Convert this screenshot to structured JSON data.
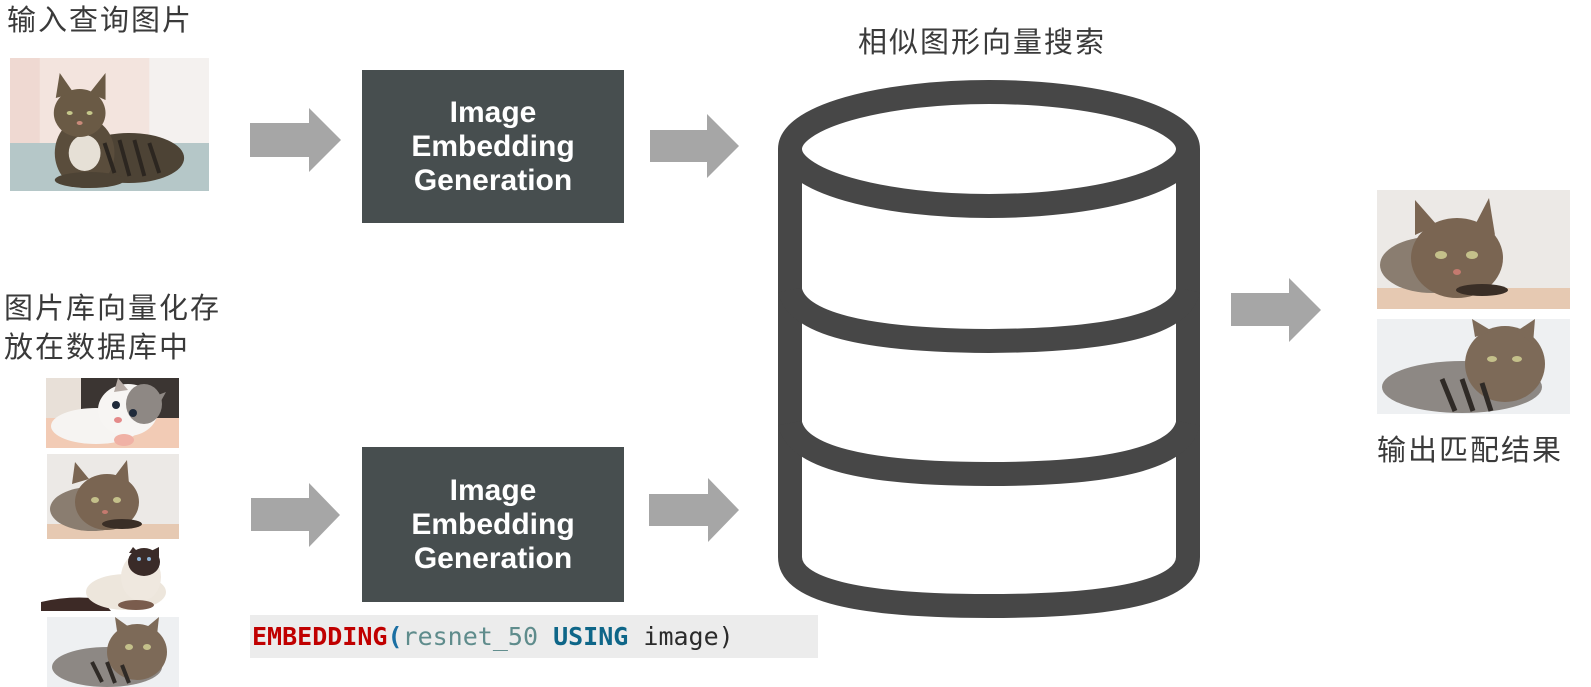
{
  "labels": {
    "query_input": "输入查询图片",
    "gallery_storage_line1": "图片库向量化存",
    "gallery_storage_line2": "放在数据库中",
    "similarity_search": "相似图形向量搜索",
    "output_results": "输出匹配结果"
  },
  "embedding_boxes": [
    {
      "lines": [
        "Image",
        "Embedding",
        "Generation"
      ]
    },
    {
      "lines": [
        "Image",
        "Embedding",
        "Generation"
      ]
    }
  ],
  "code_snippet": {
    "function": "EMBEDDING",
    "open_paren": "(",
    "model": "resnet_50",
    "keyword": "USING",
    "column": "image",
    "close_paren": ")"
  },
  "images": {
    "query": {
      "icon": "tabby-cat-on-sofa-photo"
    },
    "gallery": [
      {
        "icon": "kitten-photo"
      },
      {
        "icon": "tabby-cat-lying-photo"
      },
      {
        "icon": "siamese-cat-photo"
      },
      {
        "icon": "longhair-tabby-cat-photo"
      }
    ],
    "results": [
      {
        "icon": "tabby-cat-lying-photo"
      },
      {
        "icon": "longhair-tabby-cat-photo"
      }
    ]
  },
  "colors": {
    "box_fill": "#474e4f",
    "arrow_fill": "#a6a6a6",
    "database_stroke": "#474747",
    "code_keyword_red": "#c00000",
    "code_keyword_blue": "#0e6688"
  }
}
